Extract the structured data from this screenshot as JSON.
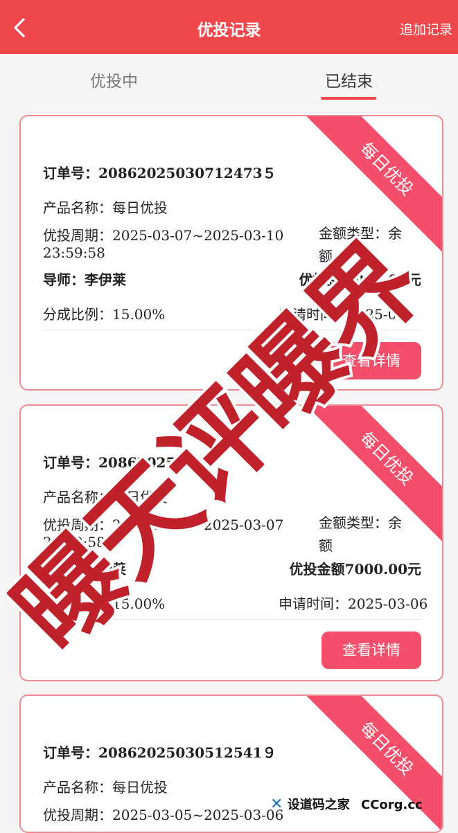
{
  "header": {
    "title": "优投记录",
    "add_label": "追加记录"
  },
  "tabs": [
    {
      "label": "优投中"
    },
    {
      "label": "已结束"
    }
  ],
  "labels": {
    "order": "订单号：",
    "product": "产品名称：",
    "period": "优投周期：",
    "amount_type": "金额类型：",
    "mentor": "导师：",
    "invest_amount": "优投金额",
    "share_ratio": "分成比例：",
    "apply_time": "申请时间："
  },
  "cards": [
    {
      "ribbon": "每日优投",
      "order_no": "20862025030712473５",
      "product_name": "每日优投",
      "period_line1": "2025-03-07~2025-03-10",
      "period_line2": "23:59:58",
      "amount_type_line1": "余",
      "amount_type_line2": "额",
      "mentor": "李伊莱",
      "invest_amount": "000.00元",
      "share_ratio": "15.00%",
      "apply_time": "2025-03-",
      "detail_button": "查看详情"
    },
    {
      "ribbon": "每日优投",
      "order_no": "2086202503",
      "product_name": "每日优投",
      "period_line1": "2025-03-06~2025-03-07",
      "period_line2": "23:59:58",
      "amount_type_line1": "余",
      "amount_type_line2": "额",
      "mentor": "李伊莱",
      "invest_amount": "7000.00元",
      "share_ratio": "15.00%",
      "apply_time": "2025-03-06",
      "detail_button": "查看详情"
    },
    {
      "ribbon": "每日优投",
      "order_no": "20862025030512541９",
      "product_name": "每日优投",
      "period_line1": "2025-03-05~2025-03-06"
    }
  ],
  "watermark": "曝天评曝界",
  "footer": {
    "logo_text": "设道码之家",
    "domain": "CCorg.cc"
  },
  "colors": {
    "header_bg": "#f0474d",
    "ribbon_bg": "#f34f6b",
    "card_border": "#f08a92",
    "watermark": "#c0222b"
  }
}
